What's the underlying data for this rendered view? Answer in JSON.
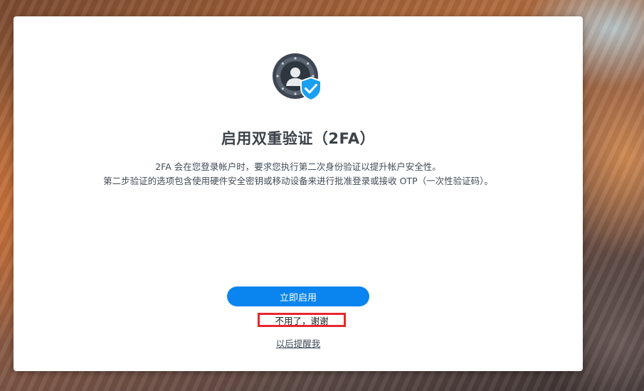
{
  "dialog": {
    "icon": "shield-check-user-icon",
    "title": "启用双重验证（2FA）",
    "description_line1": "2FA 会在您登录帐户时，要求您执行第二次身份验证以提升帐户安全性。",
    "description_line2": "第二步验证的选项包含使用硬件安全密钥或移动设备来进行批准登录或接收 OTP（一次性验证码）。",
    "primary_button_label": "立即启用",
    "decline_label": "不用了，谢谢",
    "remind_later_label": "以后提醒我"
  },
  "colors": {
    "primary": "#0a84ee",
    "highlight_box": "#e8262e",
    "shield": "#1aa0f0"
  }
}
